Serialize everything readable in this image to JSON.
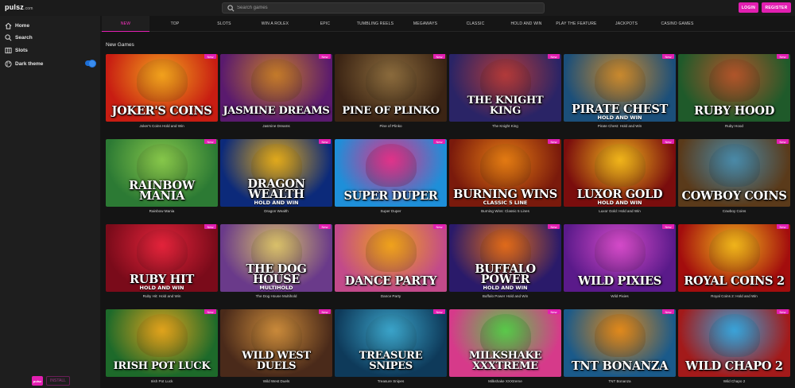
{
  "header": {
    "logo": "pulsz",
    "logo_suffix": ".com",
    "search_placeholder": "Search games",
    "login_label": "LOGIN",
    "register_label": "REGISTER"
  },
  "sidebar": {
    "items": [
      {
        "label": "Home",
        "icon": "home-icon"
      },
      {
        "label": "Search",
        "icon": "search-icon"
      },
      {
        "label": "Slots",
        "icon": "slots-icon"
      },
      {
        "label": "Dark theme",
        "icon": "palette-icon"
      }
    ],
    "dark_theme_on": true,
    "app_badge": "pulsz",
    "install_label": "INSTALL"
  },
  "tabs": [
    "NEW",
    "TOP",
    "SLOTS",
    "WIN A ROLEX",
    "EPIC",
    "TUMBLING REELS",
    "MEGAWAYS",
    "CLASSIC",
    "HOLD AND WIN",
    "PLAY THE FEATURE",
    "JACKPOTS",
    "CASINO GAMES"
  ],
  "active_tab": "NEW",
  "section_title": "New Games",
  "badge_label": "New",
  "games": [
    {
      "name": "Joker's Coins Hold and Win",
      "art_title": "JOKER'S COINS",
      "art_sub": "",
      "colors": [
        "#c81d12",
        "#f2a11c"
      ]
    },
    {
      "name": "Jasmine Dreams",
      "art_title": "JASMINE DREAMS",
      "art_sub": "",
      "colors": [
        "#5a1a6e",
        "#c47a2a"
      ]
    },
    {
      "name": "Pine of Plinko",
      "art_title": "PINE OF PLINKO",
      "art_sub": "",
      "colors": [
        "#3b2414",
        "#8a6a3c"
      ]
    },
    {
      "name": "The Knight King",
      "art_title": "THE KNIGHT KING",
      "art_sub": "",
      "colors": [
        "#2a2466",
        "#b23a3a"
      ]
    },
    {
      "name": "Pirate Chest: Hold and Win",
      "art_title": "PIRATE CHEST",
      "art_sub": "HOLD AND WIN",
      "colors": [
        "#1b4f7a",
        "#c9892e"
      ]
    },
    {
      "name": "Ruby Hood",
      "art_title": "RUBY HOOD",
      "art_sub": "",
      "colors": [
        "#1f5a2a",
        "#b0552a"
      ]
    },
    {
      "name": "Rainbow Mania",
      "art_title": "RAINBOW MANIA",
      "art_sub": "",
      "colors": [
        "#2c7a34",
        "#86c74a"
      ]
    },
    {
      "name": "Dragon Wealth",
      "art_title": "DRAGON WEALTH",
      "art_sub": "HOLD AND WIN",
      "colors": [
        "#0c2a7a",
        "#e0a91c"
      ]
    },
    {
      "name": "Super Duper",
      "art_title": "SUPER DUPER",
      "art_sub": "",
      "colors": [
        "#1e8fd9",
        "#e0338a"
      ]
    },
    {
      "name": "Burning Wins: Classic 5 Lines",
      "art_title": "BURNING WINS",
      "art_sub": "CLASSIC 5 LINE",
      "colors": [
        "#7a1a0c",
        "#e37a12"
      ]
    },
    {
      "name": "Luxor Gold: Hold and Win",
      "art_title": "LUXOR GOLD",
      "art_sub": "HOLD AND WIN",
      "colors": [
        "#7a0d0d",
        "#f0b41a"
      ]
    },
    {
      "name": "Cowboy Coins",
      "art_title": "COWBOY COINS",
      "art_sub": "",
      "colors": [
        "#5a3a1a",
        "#4a8aa8"
      ]
    },
    {
      "name": "Ruby Hit: Hold and Win",
      "art_title": "RUBY HIT",
      "art_sub": "HOLD AND WIN",
      "colors": [
        "#7a0b1a",
        "#e3233a"
      ]
    },
    {
      "name": "The Dog House Multihold",
      "art_title": "THE DOG HOUSE",
      "art_sub": "MULTIHOLD",
      "colors": [
        "#6a3a8a",
        "#d9c06a"
      ]
    },
    {
      "name": "Dance Party",
      "art_title": "DANCE PARTY",
      "art_sub": "",
      "colors": [
        "#c24a8a",
        "#f0a21c"
      ]
    },
    {
      "name": "Buffalo Power Hold and Win",
      "art_title": "BUFFALO POWER",
      "art_sub": "HOLD AND WIN",
      "colors": [
        "#2a1a6a",
        "#e06a1a"
      ]
    },
    {
      "name": "Wild Pixies",
      "art_title": "WILD PIXIES",
      "art_sub": "",
      "colors": [
        "#5a1a8a",
        "#d44ac9"
      ]
    },
    {
      "name": "Royal Coins 2: Hold and Win",
      "art_title": "ROYAL COINS 2",
      "art_sub": "",
      "colors": [
        "#a30d0d",
        "#f0b41a"
      ]
    },
    {
      "name": "Irish Pot Luck",
      "art_title": "IRISH POT LUCK",
      "art_sub": "",
      "colors": [
        "#1d6a2a",
        "#e0a31c"
      ]
    },
    {
      "name": "Wild West Duels",
      "art_title": "WILD WEST DUELS",
      "art_sub": "",
      "colors": [
        "#4a2a1a",
        "#c9893a"
      ]
    },
    {
      "name": "Treasure Snipes",
      "art_title": "TREASURE SNIPES",
      "art_sub": "",
      "colors": [
        "#0e3a5a",
        "#3aa3c9"
      ]
    },
    {
      "name": "Milkshake XXXtreme",
      "art_title": "MILKSHAKE XXXTREME",
      "art_sub": "",
      "colors": [
        "#d63a8a",
        "#5ac94a"
      ]
    },
    {
      "name": "TNT Bonanza",
      "art_title": "TNT BONANZA",
      "art_sub": "",
      "colors": [
        "#1a5a8a",
        "#e0891c"
      ]
    },
    {
      "name": "Wild Chapo 2",
      "art_title": "WILD CHAPO 2",
      "art_sub": "",
      "colors": [
        "#a31a1a",
        "#3aa3d9"
      ]
    }
  ]
}
